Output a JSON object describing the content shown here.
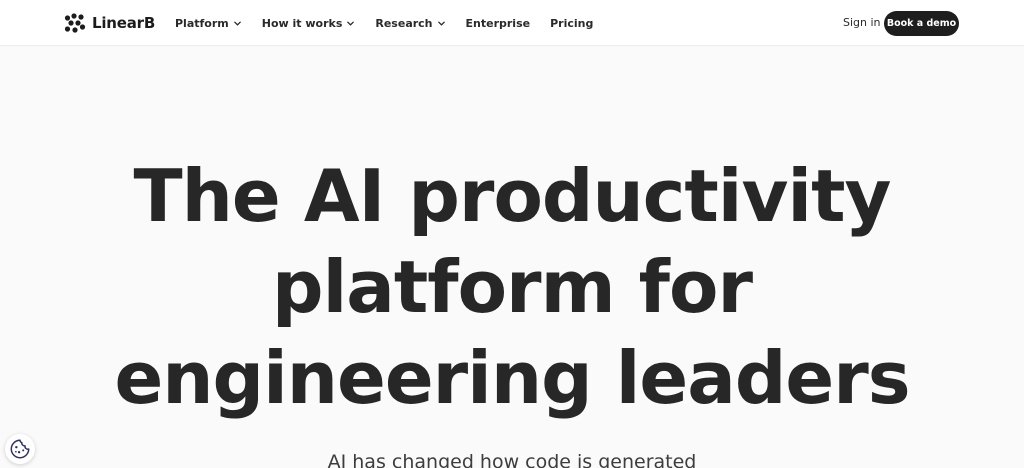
{
  "nav": {
    "logo_text": "LinearB",
    "items": [
      {
        "label": "Platform",
        "has_dropdown": true
      },
      {
        "label": "How it works",
        "has_dropdown": true
      },
      {
        "label": "Research",
        "has_dropdown": true
      },
      {
        "label": "Enterprise",
        "has_dropdown": false
      },
      {
        "label": "Pricing",
        "has_dropdown": false
      }
    ],
    "sign_in": "Sign in",
    "cta": "Book a demo"
  },
  "hero": {
    "title_lines": [
      "The AI productivity",
      "platform for",
      "engineering leaders"
    ],
    "subtitle": "AI has changed how code is generated"
  },
  "cookie": {
    "icon": "cookie-icon"
  },
  "colors": {
    "text": "#262626",
    "cta_bg": "#1e1e1e",
    "cta_text": "#ffffff",
    "page_bg": "#fafafa",
    "nav_bg": "#ffffff",
    "cookie_accent": "#2b2f6e"
  }
}
